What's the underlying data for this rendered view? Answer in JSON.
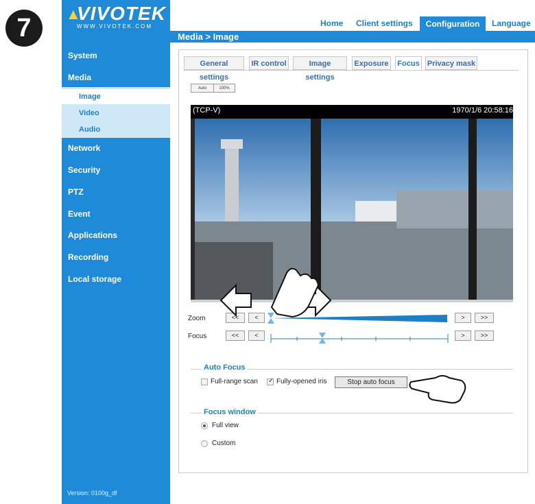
{
  "step_badge": "7",
  "logo": {
    "brand": "VIVOTEK",
    "url_text": "WWW.VIVOTEK.COM"
  },
  "top_nav": [
    "Home",
    "Client settings",
    "Configuration",
    "Language"
  ],
  "breadcrumb": "Media  > Image",
  "sidebar": {
    "items": [
      "System",
      "Media",
      "Network",
      "Security",
      "PTZ",
      "Event",
      "Applications",
      "Recording",
      "Local storage"
    ],
    "media_sub": [
      "Image",
      "Video",
      "Audio"
    ],
    "version": "Version: 0100g_df"
  },
  "tabs": [
    "General settings",
    "IR control",
    "Image settings",
    "Exposure",
    "Focus",
    "Privacy mask"
  ],
  "view_buttons": [
    "Auto",
    "100%"
  ],
  "video": {
    "connection": "(TCP-V)",
    "timestamp": "1970/1/6 20:58:16"
  },
  "zoom": {
    "label": "Zoom",
    "buttons": [
      "<<",
      "<",
      ">",
      ">>"
    ]
  },
  "focus": {
    "label": "Focus",
    "buttons": [
      "<<",
      "<",
      ">",
      ">>"
    ]
  },
  "auto_focus": {
    "legend": "Auto Focus",
    "full_range_scan": "Full-range scan",
    "full_range_checked": false,
    "fully_opened_iris": "Fully-opened iris",
    "iris_checked": true,
    "stop_button": "Stop auto focus"
  },
  "focus_window": {
    "legend": "Focus window",
    "options": [
      "Full view",
      "Custom"
    ],
    "selected": "Full view"
  },
  "colors": {
    "accent_blue": "#1f8ad7",
    "link_blue": "#1f7fc4",
    "submenu_bg": "#cfe8f8"
  }
}
